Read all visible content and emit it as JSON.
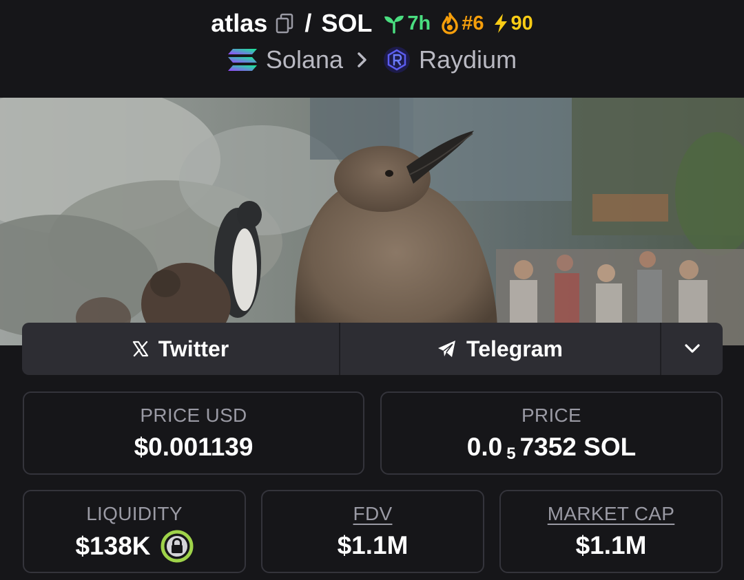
{
  "header": {
    "token_symbol": "atlas",
    "separator": "/",
    "quote_symbol": "SOL",
    "age": "7h",
    "rank": "#6",
    "boosts": "90",
    "chain": "Solana",
    "dex": "Raydium"
  },
  "banner": {
    "icon": "penguin-banner-image"
  },
  "social": {
    "twitter_label": "Twitter",
    "telegram_label": "Telegram"
  },
  "stats": {
    "price_usd_label": "PRICE USD",
    "price_usd_value": "$0.001139",
    "price_label": "PRICE",
    "price_prefix": "0.0",
    "price_zero_count": "5",
    "price_digits": "7352 SOL",
    "liquidity_label": "LIQUIDITY",
    "liquidity_value": "$138K",
    "fdv_label": "FDV",
    "fdv_value": "$1.1M",
    "market_cap_label": "MARKET CAP",
    "market_cap_value": "$1.1M"
  },
  "colors": {
    "age": "#4ade80",
    "rank": "#f59e0b",
    "boost": "#facc15",
    "lock_ring": "#9fd34a"
  }
}
